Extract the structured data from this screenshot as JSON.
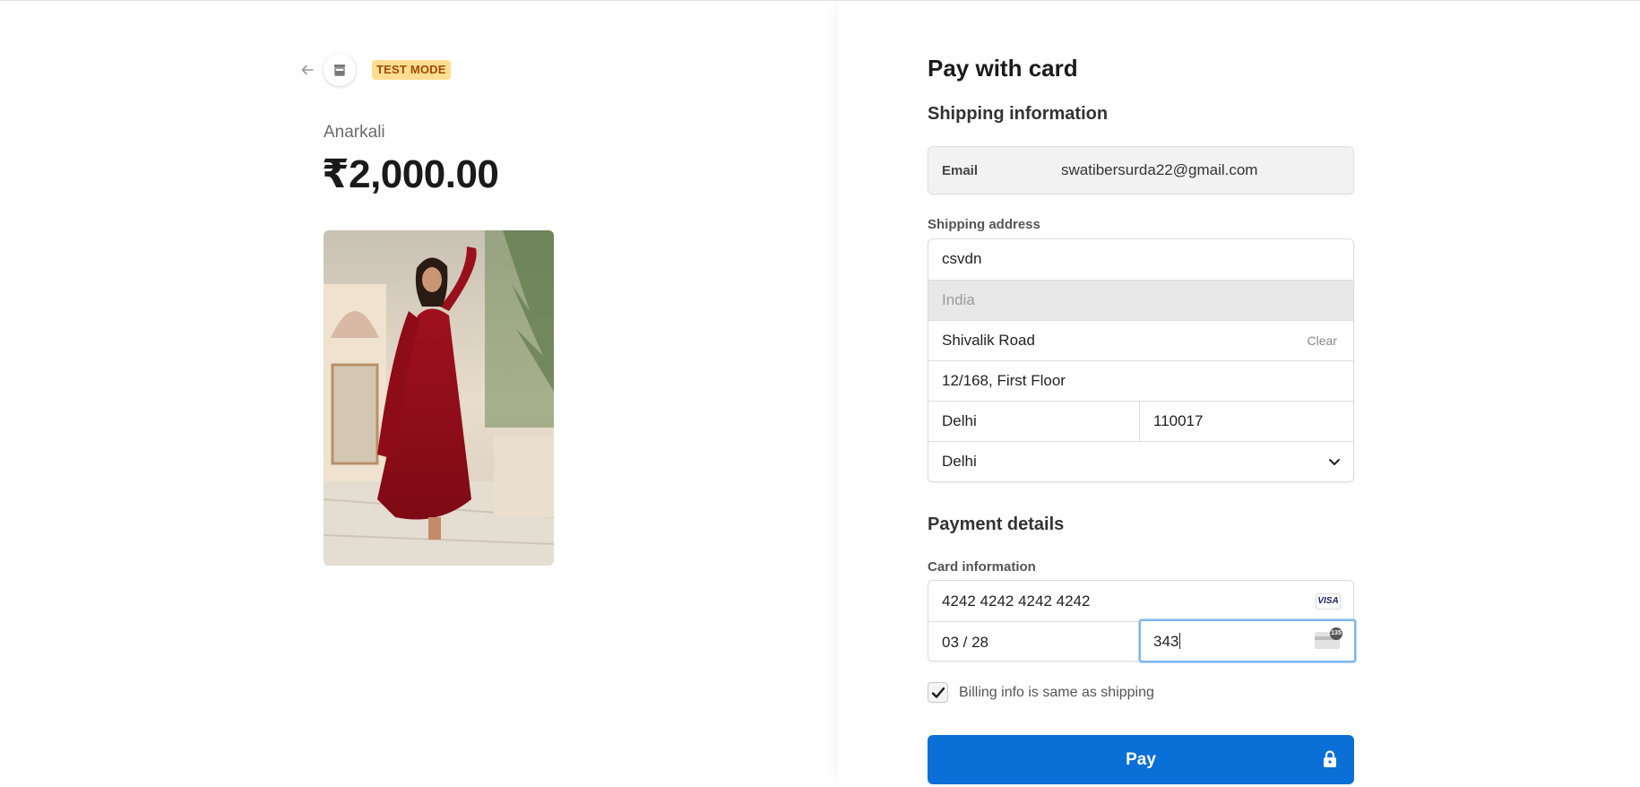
{
  "summary": {
    "test_mode_badge": "TEST MODE",
    "product_name": "Anarkali",
    "price": "₹2,000.00"
  },
  "checkout": {
    "title": "Pay with card",
    "shipping_heading": "Shipping information",
    "email_label": "Email",
    "email_value": "swatibersurda22@gmail.com",
    "shipping_address_label": "Shipping address",
    "name_value": "csvdn",
    "country_value": "India",
    "address_line1": "Shivalik Road",
    "clear_label": "Clear",
    "address_line2": "12/168, First Floor",
    "city_value": "Delhi",
    "postal_value": "110017",
    "state_value": "Delhi",
    "payment_heading": "Payment details",
    "card_info_label": "Card information",
    "card_number": "4242 4242 4242 4242",
    "card_brand": "VISA",
    "expiry": "03 / 28",
    "cvc": "343",
    "cvc_badge": "135",
    "billing_same_label": "Billing info is same as shipping",
    "billing_same_checked": true,
    "pay_label": "Pay"
  },
  "colors": {
    "accent": "#0a6fd6",
    "test_badge_bg": "#ffde92",
    "test_badge_text": "#a24a00"
  },
  "icons": {
    "back": "arrow-left-icon",
    "store": "store-icon",
    "chevron": "chevron-down-icon",
    "lock": "lock-icon",
    "check": "checkmark-icon"
  }
}
